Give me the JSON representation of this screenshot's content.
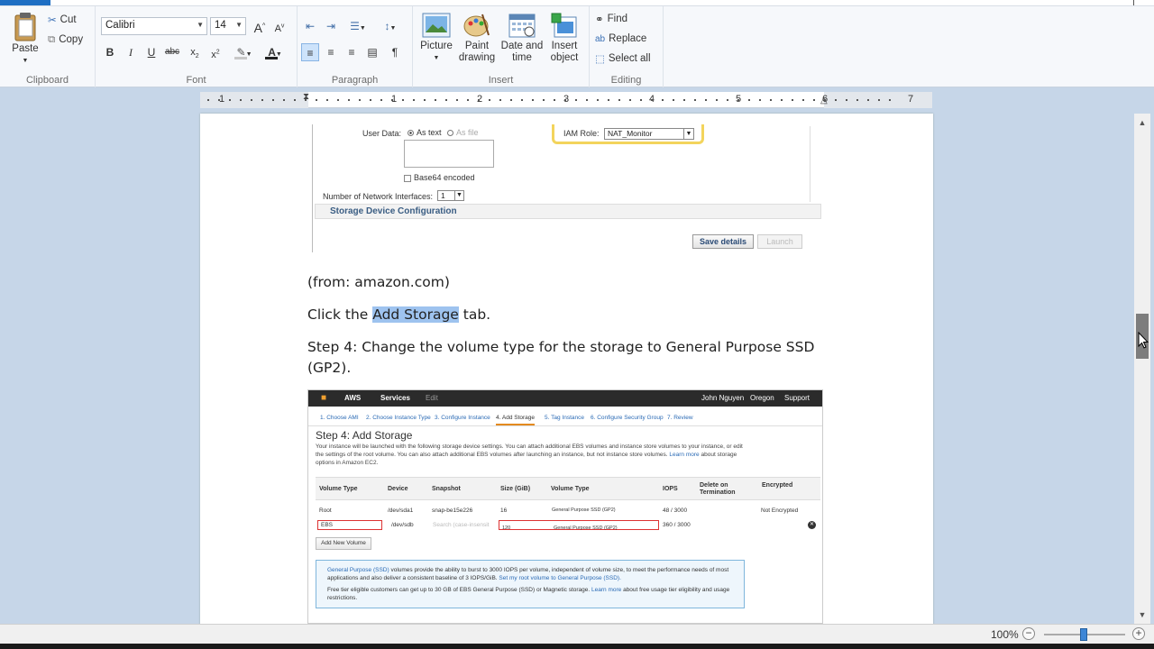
{
  "ribbon": {
    "clipboard": {
      "label": "Clipboard",
      "paste": "Paste",
      "cut": "Cut",
      "copy": "Copy"
    },
    "font": {
      "label": "Font",
      "family": "Calibri",
      "size": "14"
    },
    "paragraph": {
      "label": "Paragraph"
    },
    "insert": {
      "label": "Insert",
      "picture": "Picture",
      "paint": "Paint\ndrawing",
      "paint_l1": "Paint",
      "paint_l2": "drawing",
      "date_l1": "Date and",
      "date_l2": "time",
      "object_l1": "Insert",
      "object_l2": "object"
    },
    "editing": {
      "label": "Editing",
      "find": "Find",
      "replace": "Replace",
      "select_all": "Select all"
    }
  },
  "ruler": {
    "numbers": [
      "1",
      "1",
      "2",
      "3",
      "4",
      "5",
      "6",
      "7"
    ]
  },
  "document": {
    "shot1": {
      "user_data": "User Data:",
      "as_text": "As text",
      "as_file": "As file",
      "base64": "Base64 encoded",
      "iam_role": "IAM Role:",
      "iam_value": "NAT_Monitor",
      "num_interfaces": "Number of Network Interfaces:",
      "num_interfaces_value": "1",
      "storage_config": "Storage Device Configuration",
      "save_details": "Save details",
      "launch": "Launch"
    },
    "source": "(from: amazon.com)",
    "click_pre": "Click the ",
    "click_hl": "Add Storage",
    "click_post": " tab.",
    "step4_l1": "Step 4: Change the volume type for the storage to General Purpose SSD",
    "step4_l2": "(GP2).",
    "shot2": {
      "aws": "AWS",
      "services": "Services",
      "edit": "Edit",
      "user": "John Nguyen",
      "region": "Oregon",
      "support": "Support",
      "steps": [
        "1. Choose AMI",
        "2. Choose Instance Type",
        "3. Configure Instance",
        "4. Add Storage",
        "5. Tag Instance",
        "6. Configure Security Group",
        "7. Review"
      ],
      "heading": "Step 4: Add Storage",
      "desc": "Your instance will be launched with the following storage device settings. You can attach additional EBS volumes and instance store volumes to your instance, or edit the settings of the root volume. You can also attach additional EBS volumes after launching an instance, but not instance store volumes.",
      "desc_link": "Learn more",
      "desc_tail": "about storage options in Amazon EC2.",
      "headers": [
        "Volume Type",
        "Device",
        "Snapshot",
        "Size (GiB)",
        "Volume Type",
        "IOPS",
        "Delete on Termination",
        "Encrypted"
      ],
      "row1": [
        "Root",
        "/dev/sda1",
        "snap-be15e226",
        "16",
        "General Purpose SSD (GP2)",
        "48 / 3000",
        "",
        "Not Encrypted"
      ],
      "row2": [
        "EBS",
        "/dev/sdb",
        "Search (case-insensit",
        "120",
        "General Purpose SSD (GP2)",
        "360 / 3000"
      ],
      "add_volume": "Add New Volume",
      "info1_link": "General Purpose (SSD)",
      "info1": "volumes provide the ability to burst to 3000 IOPS per volume, independent of volume size, to meet the performance needs of most applications and also deliver a consistent baseline of 3 IOPS/GiB.",
      "info1_link2": "Set my root volume to General Purpose (SSD).",
      "info2": "Free tier eligible customers can get up to 30 GB of EBS General Purpose (SSD) or Magnetic storage.",
      "info2_link": "Learn more",
      "info2_tail": "about free usage tier eligibility and usage restrictions."
    }
  },
  "status": {
    "zoom": "100%"
  }
}
